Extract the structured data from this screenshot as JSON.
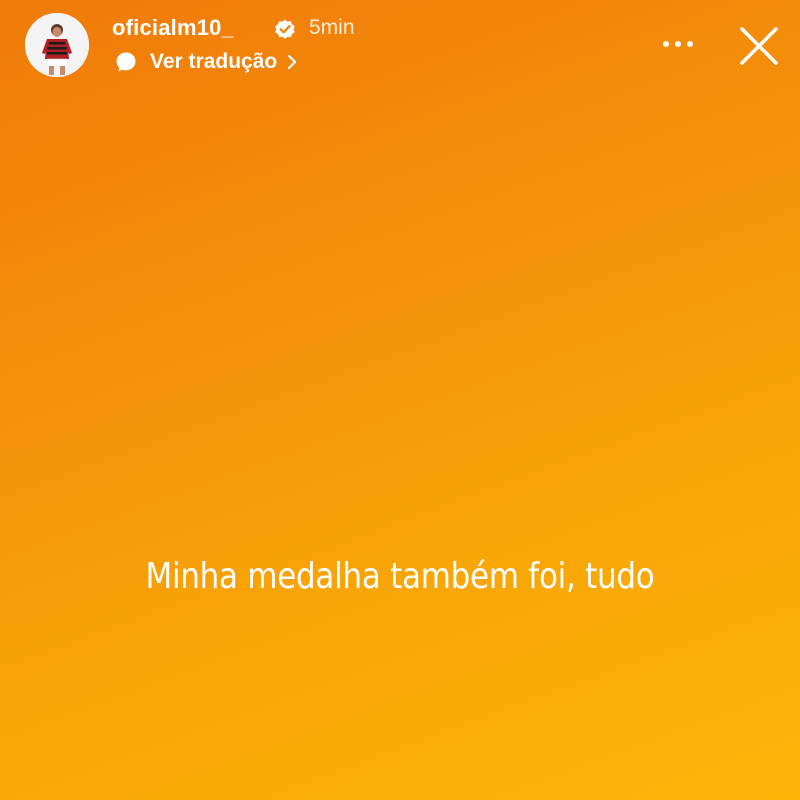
{
  "story": {
    "username": "oficialm10_",
    "time_ago": "5min",
    "translate_label": "Ver tradução",
    "caption": "Minha medalha também foi, tudo"
  },
  "icons": {
    "verified": "verified-badge-icon",
    "translate": "speech-bubble-icon",
    "chevron": "chevron-right-icon",
    "more": "more-options-icon",
    "close": "close-icon"
  },
  "colors": {
    "gradient_start": "#f07a0a",
    "gradient_end": "#fbb608",
    "text": "#ffffff"
  }
}
